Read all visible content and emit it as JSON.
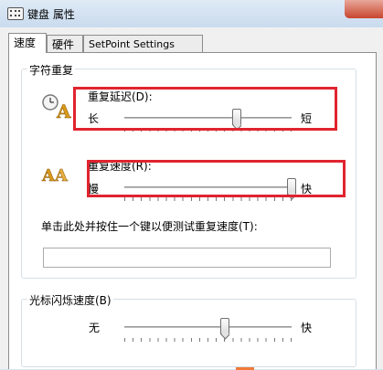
{
  "window": {
    "title": "键盘 属性"
  },
  "tabs": [
    {
      "label": "速度",
      "active": true
    },
    {
      "label": "硬件",
      "active": false
    },
    {
      "label": "SetPoint Settings",
      "active": false
    }
  ],
  "char_repeat": {
    "group_label": "字符重复",
    "delay": {
      "label": "重复延迟(D):",
      "min_label": "长",
      "max_label": "短",
      "value_fraction": 0.67
    },
    "rate": {
      "label": "重复速度(R):",
      "min_label": "慢",
      "max_label": "快",
      "value_fraction": 1.0
    },
    "test_label": "单击此处并按住一个键以便测试重复速度(T):",
    "test_value": ""
  },
  "cursor_blink": {
    "group_label": "光标闪烁速度(B)",
    "min_label": "无",
    "max_label": "快",
    "value_fraction": 0.6
  },
  "colors": {
    "highlight": "#e0242f",
    "accent": "#f07a3a"
  },
  "icons": [
    "keyboard-icon",
    "clock-letter-a-icon",
    "double-letter-a-icon",
    "close-icon"
  ]
}
